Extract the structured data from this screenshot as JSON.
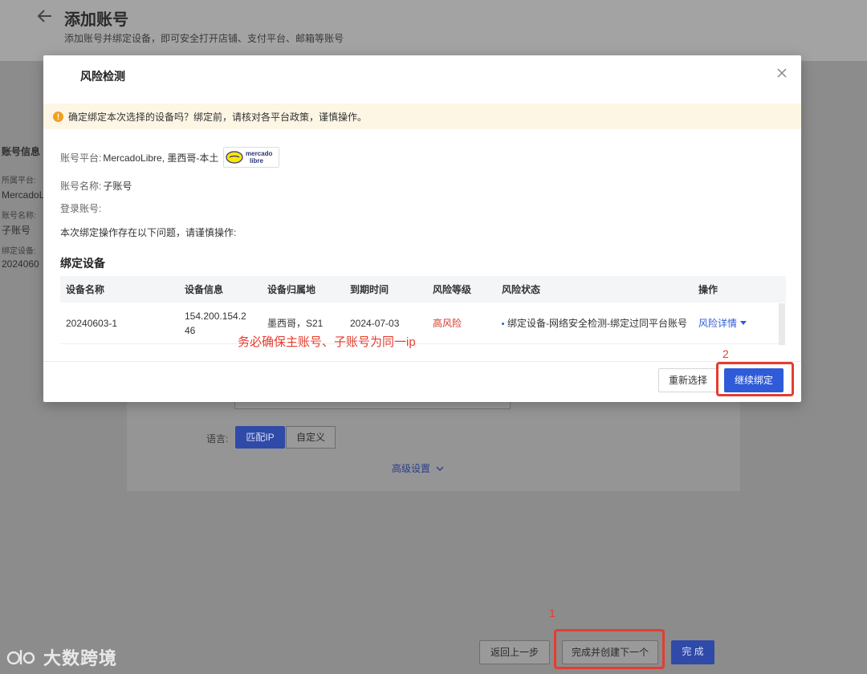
{
  "page": {
    "title": "添加账号",
    "subtitle": "添加账号并绑定设备，即可安全打开店铺、支付平台、邮箱等账号"
  },
  "left_panel": {
    "section": "账号信息",
    "platform_label": "所属平台:",
    "platform_value": "MercadoL",
    "name_label": "账号名称:",
    "name_value": "子账号",
    "device_label": "绑定设备:",
    "device_value": "2024060"
  },
  "form": {
    "language_label": "语言:",
    "match_ip": "匹配IP",
    "custom": "自定义",
    "advanced": "高级设置"
  },
  "footer": {
    "prev": "返回上一步",
    "create_next": "完成并创建下一个",
    "finish": "完 成"
  },
  "annotations": {
    "step1": "1",
    "step2": "2",
    "note": "务必确保主账号、子账号为同一ip"
  },
  "watermark": "大数跨境",
  "modal": {
    "title": "风险检测",
    "warning": "确定绑定本次选择的设备吗？绑定前，请核对各平台政策，谨慎操作。",
    "platform_label": "账号平台:",
    "platform_value": "MercadoLibre, 墨西哥-本土",
    "logo_text_1": "mercado",
    "logo_text_2": "libre",
    "name_label": "账号名称:",
    "name_value": "子账号",
    "login_label": "登录账号:",
    "notice": "本次绑定操作存在以下问题，请谨慎操作:",
    "section_title": "绑定设备",
    "table": {
      "headers": [
        "设备名称",
        "设备信息",
        "设备归属地",
        "到期时间",
        "风险等级",
        "风险状态",
        "操作"
      ],
      "rows": [
        {
          "name": "20240603-1",
          "info_line1": "154.200.154.2",
          "info_line2": "46",
          "location": "墨西哥，S21",
          "expiry": "2024-07-03",
          "risk_level": "高风险",
          "risk_status": "绑定设备-网络安全检测-绑定过同平台账号",
          "action": "风险详情"
        }
      ]
    },
    "reselect": "重新选择",
    "continue": "继续绑定"
  },
  "colors": {
    "primary": "#2f5bd8",
    "danger": "#d03a2e",
    "annotation": "#e43d2f",
    "warning_bg": "#fdf6e4"
  }
}
